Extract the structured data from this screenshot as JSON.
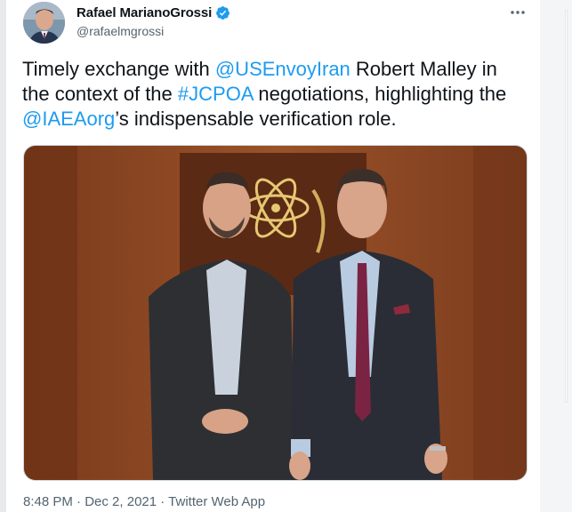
{
  "author": {
    "display_name": "Rafael MarianoGrossi",
    "handle": "@rafaelmgrossi",
    "verified": true,
    "avatar_icon": "profile-photo"
  },
  "tweet": {
    "text_segments": [
      {
        "text": "Timely exchange with ",
        "type": "text"
      },
      {
        "text": "@USEnvoyIran",
        "type": "mention"
      },
      {
        "text": " Robert Malley in the context of the ",
        "type": "text"
      },
      {
        "text": "#JCPOA",
        "type": "hashtag"
      },
      {
        "text": " negotiations, highlighting the ",
        "type": "text"
      },
      {
        "text": "@IAEAorg",
        "type": "mention"
      },
      {
        "text": "’s indispensable verification role.",
        "type": "text"
      }
    ]
  },
  "meta": {
    "time": "8:48 PM",
    "sep1": " · ",
    "date": "Dec 2, 2021",
    "sep2": " · ",
    "source": "Twitter Web App"
  },
  "colors": {
    "link": "#1d9bf0",
    "text": "#0f1419",
    "secondary": "#536471",
    "verified": "#1d9bf0"
  },
  "icons": {
    "more": "more-horizontal-icon",
    "verified": "verified-badge-icon"
  }
}
